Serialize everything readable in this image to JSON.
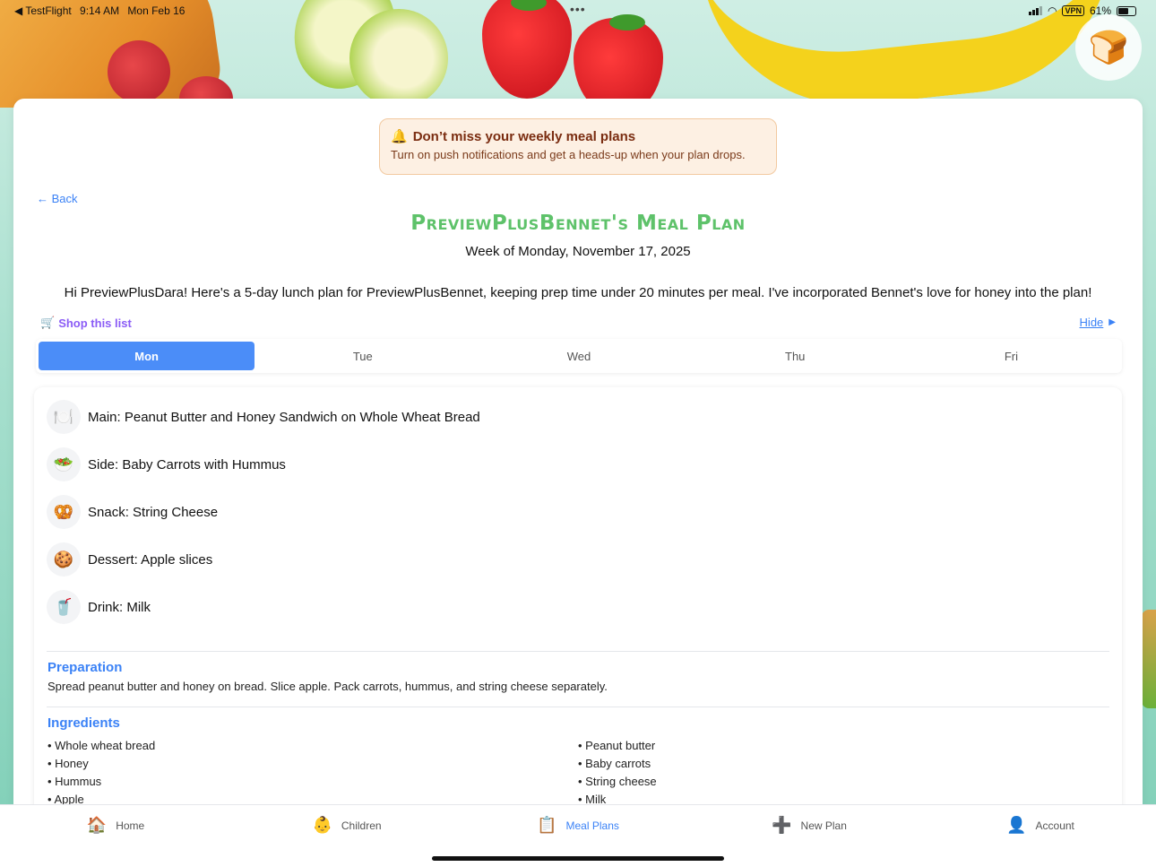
{
  "status_bar": {
    "back_app": "◀ TestFlight",
    "time": "9:14 AM",
    "date": "Mon Feb 16",
    "vpn": "VPN",
    "battery": "61%"
  },
  "avatar": {
    "icon": "toast-hero-icon",
    "glyph": "🍞"
  },
  "notice": {
    "icon_glyph": "🔔",
    "title": "Don’t miss your weekly meal plans",
    "text": "Turn on push notifications and get a heads-up when your plan drops."
  },
  "back_label": "← Back",
  "plan": {
    "title": "PreviewPlusBennet's Meal Plan",
    "week": "Week of Monday, November 17, 2025",
    "intro": "Hi PreviewPlusDara! Here's a 5-day lunch plan for PreviewPlusBennet, keeping prep time under 20 minutes per meal. I've incorporated Bennet's love for honey into the plan!"
  },
  "shop": {
    "glyph": "🛒",
    "label": "Shop this list"
  },
  "hide": {
    "label": "Hide",
    "glyph": "▶"
  },
  "tabs": [
    {
      "label": "Mon",
      "active": true
    },
    {
      "label": "Tue",
      "active": false
    },
    {
      "label": "Wed",
      "active": false
    },
    {
      "label": "Thu",
      "active": false
    },
    {
      "label": "Fri",
      "active": false
    }
  ],
  "meals": [
    {
      "icon": "plate-icon",
      "glyph": "🍽️",
      "text": "Main: Peanut Butter and Honey Sandwich on Whole Wheat Bread"
    },
    {
      "icon": "salad-icon",
      "glyph": "🥗",
      "text": "Side: Baby Carrots with Hummus"
    },
    {
      "icon": "pretzel-icon",
      "glyph": "🥨",
      "text": "Snack: String Cheese"
    },
    {
      "icon": "cookie-icon",
      "glyph": "🍪",
      "text": "Dessert: Apple slices"
    },
    {
      "icon": "cup-icon",
      "glyph": "🥤",
      "text": "Drink: Milk"
    }
  ],
  "preparation": {
    "title": "Preparation",
    "text": "Spread peanut butter and honey on bread. Slice apple. Pack carrots, hummus, and string cheese separately."
  },
  "ingredients": {
    "title": "Ingredients",
    "left": [
      "• Whole wheat bread",
      "• Honey",
      "• Hummus",
      "• Apple"
    ],
    "right": [
      "• Peanut butter",
      "• Baby carrots",
      "• String cheese",
      "• Milk"
    ]
  },
  "nav": [
    {
      "label": "Home",
      "icon": "house-icon",
      "glyph": "🏠",
      "active": false
    },
    {
      "label": "Children",
      "icon": "baby-icon",
      "glyph": "👶",
      "active": false
    },
    {
      "label": "Meal Plans",
      "icon": "clipboard-icon",
      "glyph": "📋",
      "active": true
    },
    {
      "label": "New Plan",
      "icon": "plus-icon",
      "glyph": "➕",
      "active": false
    },
    {
      "label": "Account",
      "icon": "person-icon",
      "glyph": "👤",
      "active": false
    }
  ],
  "colors": {
    "accent": "#3b82f6",
    "tab_active": "#4b8df8",
    "title_green": "#5ec26a",
    "shop_purple": "#8b5cf6"
  }
}
